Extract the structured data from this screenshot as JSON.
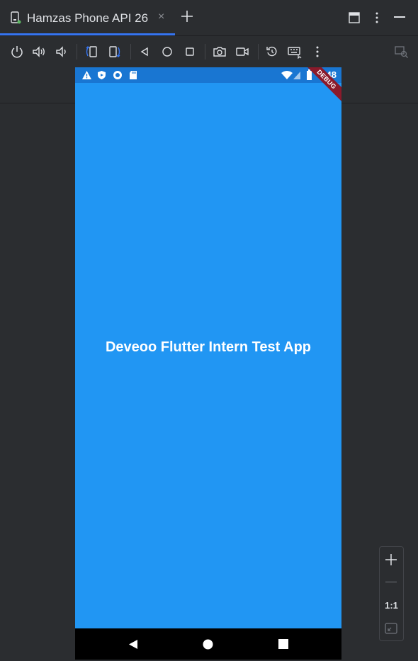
{
  "tab": {
    "title": "Hamzas Phone API 26",
    "close_glyph": "×"
  },
  "device_screen": {
    "status_time": "4:48",
    "debug_label": "DEBUG",
    "app_title": "Deveoo Flutter Intern Test App",
    "background_color": "#2196f3",
    "status_bar_color": "#1976d2"
  },
  "zoom": {
    "actual_size_label": "1:1"
  },
  "icons": {
    "tab": [
      "device-icon",
      "close-icon",
      "add-tab-icon",
      "window-restore-icon",
      "more-vertical-icon",
      "minimize-icon"
    ],
    "toolbar": [
      "power-icon",
      "volume-up-icon",
      "volume-down-icon",
      "rotate-left-icon",
      "rotate-right-icon",
      "back-icon",
      "home-icon",
      "overview-icon",
      "camera-icon",
      "record-icon",
      "reset-icon",
      "keyboard-icon",
      "more-vertical-icon",
      "layout-inspector-icon"
    ]
  },
  "accent_color": "#3574f0"
}
